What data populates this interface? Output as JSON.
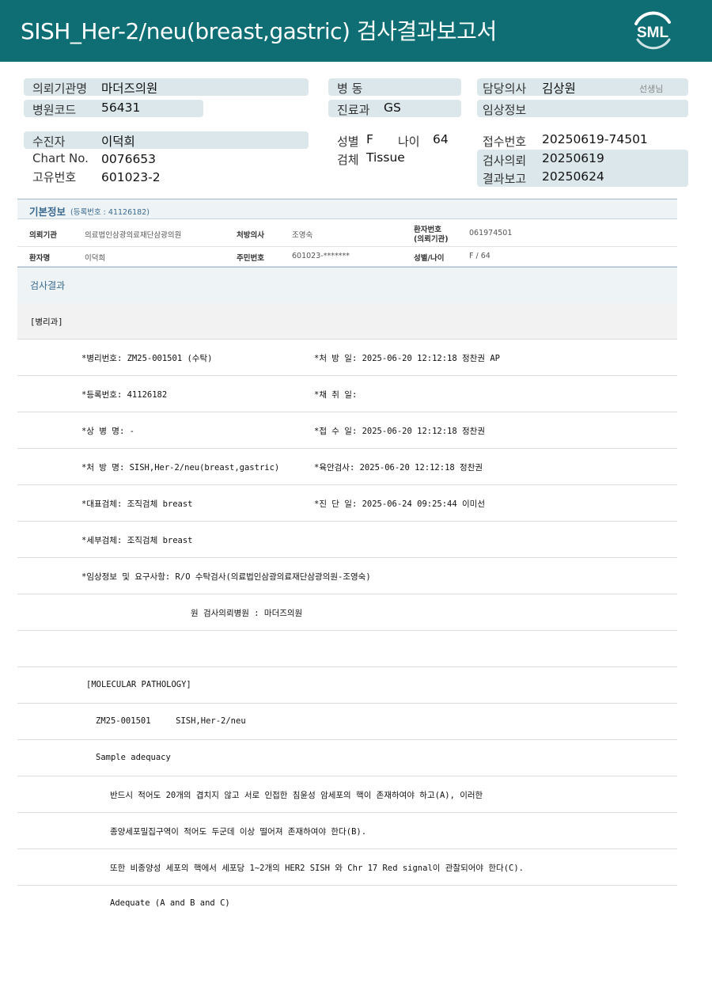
{
  "header": {
    "title": "SISH_Her-2/neu(breast,gastric) 검사결과보고서",
    "logo_text": "SML"
  },
  "info": {
    "institution_label": "의뢰기관명",
    "institution_value": "마더즈의원",
    "hospital_code_label": "병원코드",
    "hospital_code_value": "56431",
    "ward_label": "병  동",
    "ward_value": "",
    "dept_label": "진료과",
    "dept_value": "GS",
    "doctor_label": "담당의사",
    "doctor_value": "김상원",
    "doctor_suffix": "선생님",
    "clinical_label": "임상정보",
    "clinical_value": "",
    "patient_label": "수진자",
    "patient_value": "이덕희",
    "chart_label": "Chart No.",
    "chart_value": "0076653",
    "uid_label": "고유번호",
    "uid_value": "601023-2",
    "sex_label": "성별",
    "sex_value": "F",
    "age_label": "나이",
    "age_value": "64",
    "specimen_label": "검체",
    "specimen_value": "Tissue",
    "receipt_label": "접수번호",
    "receipt_value": "20250619-74501",
    "request_label": "검사의뢰",
    "request_value": "20250619",
    "report_label": "결과보고",
    "report_value": "20250624"
  },
  "basic": {
    "title": "기본정보",
    "reg": "(등록번호 : 41126182)",
    "row1": {
      "k1": "의뢰기관",
      "v1": "의료법인삼광의료재단삼광의원",
      "k2": "처방의사",
      "v2": "조영숙",
      "k3a": "환자번호",
      "k3b": "(의뢰기관)",
      "v3": "061974501"
    },
    "row2": {
      "k1": "환자명",
      "v1": "이덕희",
      "k2": "주민번호",
      "v2": "601023-*******",
      "k3": "성별/나이",
      "v3": "F / 64"
    }
  },
  "results": {
    "title": "검사결과",
    "dept": "[병리과]",
    "lines": [
      {
        "left": "*병리번호: ZM25-001501 (수탁)",
        "right": "*처 방 일: 2025-06-20 12:12:18  정찬권 AP"
      },
      {
        "left": "*등록번호: 41126182",
        "right": "*채 취 일:"
      },
      {
        "left": "*상 병 명: -",
        "right": "*접 수 일: 2025-06-20 12:12:18  정찬권"
      },
      {
        "left": "*처 방 명: SISH,Her-2/neu(breast,gastric)",
        "right": "*육안검사: 2025-06-20 12:12:18  정찬권"
      },
      {
        "left": "*대표검체: 조직검체 breast",
        "right": "*진 단 일: 2025-06-24 09:25:44  이미선"
      },
      {
        "left": "*세부검체: 조직검체 breast",
        "right": ""
      },
      {
        "left": "*임상정보 및 요구사항: R/O 수탁검사(의료법인삼광의료재단삼광의원-조영숙)",
        "right": ""
      }
    ],
    "origin": "원 검사의뢰병원 : 마더즈의원",
    "blank": "",
    "mp_header": "[MOLECULAR PATHOLOGY]",
    "mp_id": "ZM25-001501     SISH,Her-2/neu",
    "adequacy": "Sample adequacy",
    "text1": "반드시 적어도 20개의 겹치지 않고 서로 인접한 침윤성 암세포의 핵이 존재하여야 하고(A), 이러한",
    "text2": "종양세포밀집구역이 적어도 두군데 이상 떨어져 존재하여야 한다(B).",
    "text3": "또한 비종양성 세포의 핵에서 세포당 1~2개의 HER2 SISH 와 Chr 17 Red signal이 관찰되어야 한다(C).",
    "conclusion": "Adequate (A and B and C)"
  }
}
